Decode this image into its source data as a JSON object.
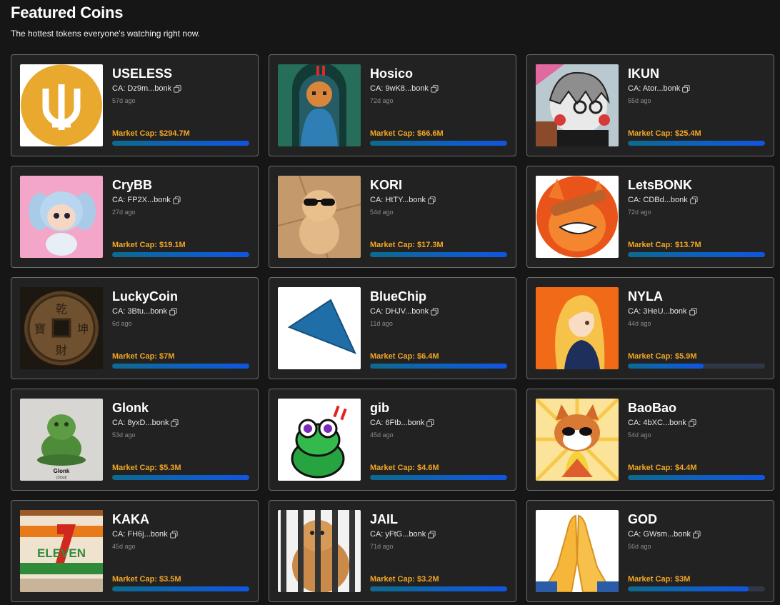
{
  "header": {
    "title": "Featured Coins",
    "subtitle": "The hottest tokens everyone's watching right now."
  },
  "coins": [
    {
      "name": "USELESS",
      "ca": "CA: Dz9m...bonk",
      "age": "57d ago",
      "market_cap": "Market Cap: $294.7M",
      "progress": 1.0
    },
    {
      "name": "Hosico",
      "ca": "CA: 9wK8...bonk",
      "age": "72d ago",
      "market_cap": "Market Cap: $66.6M",
      "progress": 1.0
    },
    {
      "name": "IKUN",
      "ca": "CA: Ator...bonk",
      "age": "55d ago",
      "market_cap": "Market Cap: $25.4M",
      "progress": 1.0
    },
    {
      "name": "CryBB",
      "ca": "CA: FP2X...bonk",
      "age": "27d ago",
      "market_cap": "Market Cap: $19.1M",
      "progress": 1.0
    },
    {
      "name": "KORI",
      "ca": "CA: HtTY...bonk",
      "age": "54d ago",
      "market_cap": "Market Cap: $17.3M",
      "progress": 1.0
    },
    {
      "name": "LetsBONK",
      "ca": "CA: CDBd...bonk",
      "age": "72d ago",
      "market_cap": "Market Cap: $13.7M",
      "progress": 1.0
    },
    {
      "name": "LuckyCoin",
      "ca": "CA: 3Btu...bonk",
      "age": "6d ago",
      "market_cap": "Market Cap: $7M",
      "progress": 1.0
    },
    {
      "name": "BlueChip",
      "ca": "CA: DHJV...bonk",
      "age": "11d ago",
      "market_cap": "Market Cap: $6.4M",
      "progress": 1.0
    },
    {
      "name": "NYLA",
      "ca": "CA: 3HeU...bonk",
      "age": "44d ago",
      "market_cap": "Market Cap: $5.9M",
      "progress": 0.55
    },
    {
      "name": "Glonk",
      "ca": "CA: 8yxD...bonk",
      "age": "53d ago",
      "market_cap": "Market Cap: $5.3M",
      "progress": 1.0
    },
    {
      "name": "gib",
      "ca": "CA: 6Ftb...bonk",
      "age": "45d ago",
      "market_cap": "Market Cap: $4.6M",
      "progress": 1.0
    },
    {
      "name": "BaoBao",
      "ca": "CA: 4bXC...bonk",
      "age": "54d ago",
      "market_cap": "Market Cap: $4.4M",
      "progress": 1.0
    },
    {
      "name": "KAKA",
      "ca": "CA: FH6j...bonk",
      "age": "45d ago",
      "market_cap": "Market Cap: $3.5M",
      "progress": 1.0
    },
    {
      "name": "JAIL",
      "ca": "CA: yFtG...bonk",
      "age": "71d ago",
      "market_cap": "Market Cap: $3.2M",
      "progress": 1.0
    },
    {
      "name": "GOD",
      "ca": "CA: GWsm...bonk",
      "age": "56d ago",
      "market_cap": "Market Cap: $3M",
      "progress": 0.88
    }
  ],
  "thumb_texts": {
    "glonk_caption": "Glonk",
    "glonk_sub": "(Stool)",
    "kaka_sign": "ELEVEN"
  },
  "icons": {
    "copy": "copy-icon"
  },
  "colors": {
    "background": "#161616",
    "card": "#222223",
    "card_border": "#6b6b6e",
    "market_cap": "#f2a623",
    "bar_fill": "#0f5fc4",
    "bar_track": "#2f3846"
  }
}
